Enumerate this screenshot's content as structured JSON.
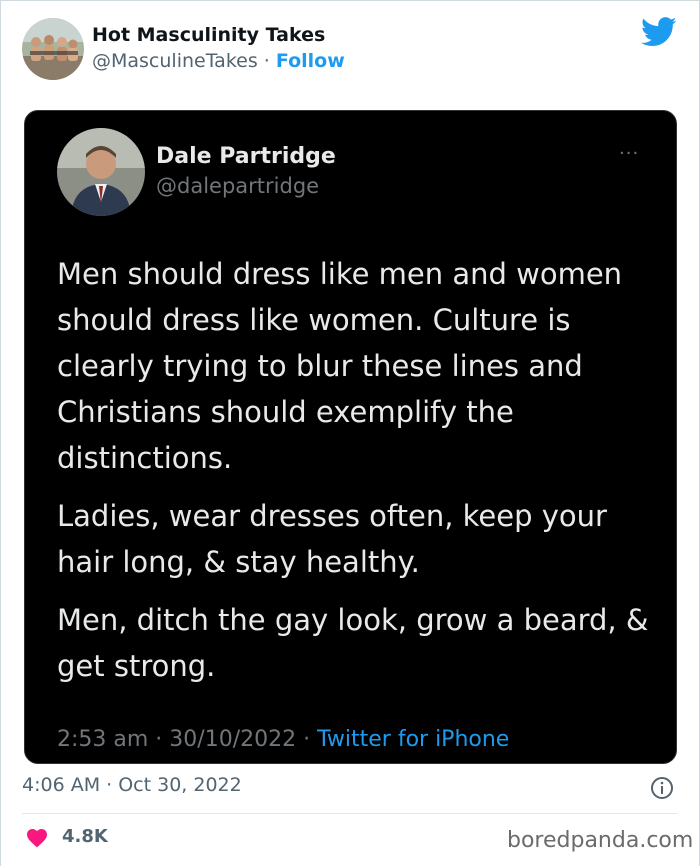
{
  "tweet": {
    "author_name": "Hot Masculinity Takes",
    "author_handle": "@MasculineTakes",
    "separator": " · ",
    "follow_label": "Follow",
    "timestamp": "4:06 AM · Oct 30, 2022",
    "likes": "4.8K"
  },
  "quoted_tweet": {
    "author_name": "Dale Partridge",
    "author_handle": "@dalepartridge",
    "more_label": "···",
    "paragraphs": [
      "Men should dress like men and women should dress like women. Culture is clearly trying to blur these lines and Christians should exemplify the distinctions.",
      "Ladies, wear dresses often, keep your hair long, & stay healthy.",
      "Men, ditch the gay look, grow a beard, & get strong."
    ],
    "time": "2:53 am",
    "date": "30/10/2022",
    "source": "Twitter for iPhone",
    "meta_separator": " · "
  },
  "watermark": "boredpanda.com",
  "colors": {
    "accent": "#1d9bf0",
    "heart": "#f91880",
    "quoted_bg": "#000000"
  },
  "icons": {
    "brand": "twitter-bird-icon",
    "info": "info-icon",
    "like": "heart-icon"
  }
}
